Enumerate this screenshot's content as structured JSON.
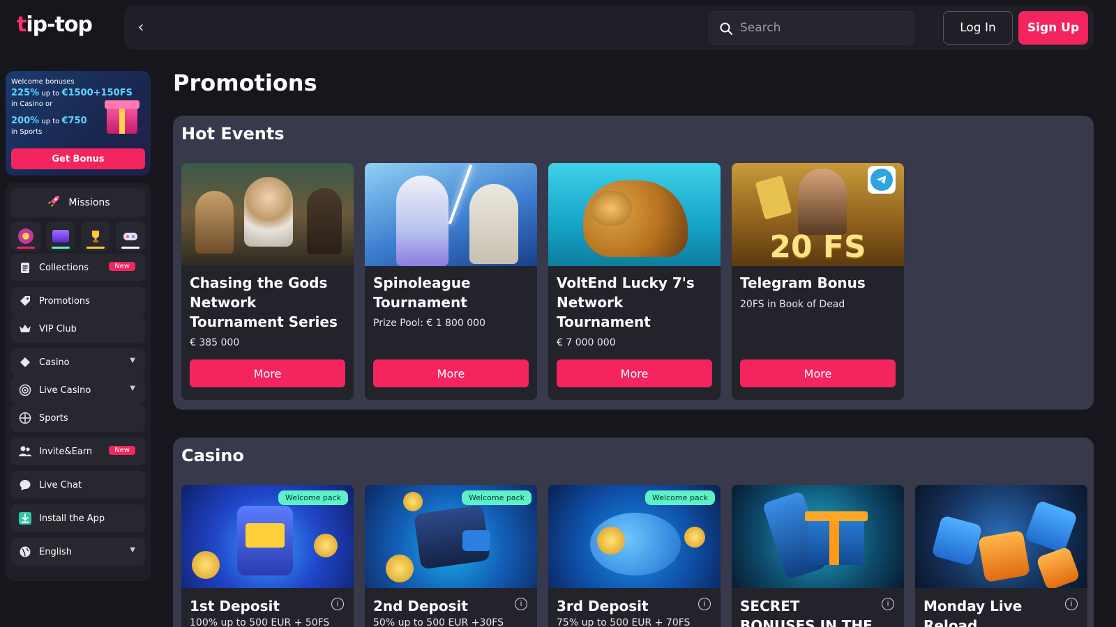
{
  "header": {
    "logo_text_a": "t",
    "logo_text_b": "ip-top",
    "search_placeholder": "Search",
    "login_label": "Log In",
    "signup_label": "Sign Up"
  },
  "sidebar": {
    "bonus": {
      "line1": "Welcome bonuses",
      "line2_big": "225%",
      "line2_small": " up to ",
      "line2_amount": "€1500+150FS",
      "line3": "in Casino or",
      "line4_big": "200%",
      "line4_small": " up to ",
      "line4_amount": "€750",
      "line5": "in Sports",
      "button": "Get Bonus"
    },
    "missions_label": "Missions",
    "items": [
      {
        "label": "Collections",
        "badge": "New"
      },
      {
        "label": "Promotions"
      },
      {
        "label": "VIP Club"
      },
      {
        "label": "Casino"
      },
      {
        "label": "Live Casino"
      },
      {
        "label": "Sports"
      },
      {
        "label": "Invite&Earn",
        "badge": "New"
      },
      {
        "label": "Live Chat"
      },
      {
        "label": "Install the App"
      },
      {
        "label": "English"
      }
    ]
  },
  "main": {
    "page_title": "Promotions",
    "hot_events": {
      "title": "Hot Events",
      "cards": [
        {
          "title": "Chasing the Gods Network Tournament Series",
          "sub": "€ 385 000",
          "button": "More"
        },
        {
          "title": "Spinoleague Tournament",
          "sub": "Prize Pool: € 1 800 000",
          "button": "More"
        },
        {
          "title": "VoltEnd Lucky 7's Network Tournament",
          "sub": "€ 7 000 000",
          "button": "More"
        },
        {
          "title": "Telegram Bonus",
          "sub": "20FS in Book of Dead",
          "button": "More",
          "image_text": "20 FS"
        }
      ]
    },
    "casino": {
      "title": "Casino",
      "cards": [
        {
          "title": "1st Deposit",
          "sub": "100% up to 500 EUR + 50FS",
          "pill": "Welcome pack"
        },
        {
          "title": "2nd Deposit",
          "sub": "50% up to 500 EUR +30FS",
          "pill": "Welcome pack"
        },
        {
          "title": "3rd Deposit",
          "sub": "75% up to 500 EUR + 70FS",
          "pill": "Welcome pack"
        },
        {
          "title": "SECRET BONUSES IN THE APP ONLY",
          "sub": ""
        },
        {
          "title": "Monday Live Reload",
          "sub": ""
        }
      ]
    }
  },
  "colors": {
    "accent": "#f4245f",
    "bg": "#16161c",
    "panel": "#1f1f27",
    "section": "#38394a"
  }
}
